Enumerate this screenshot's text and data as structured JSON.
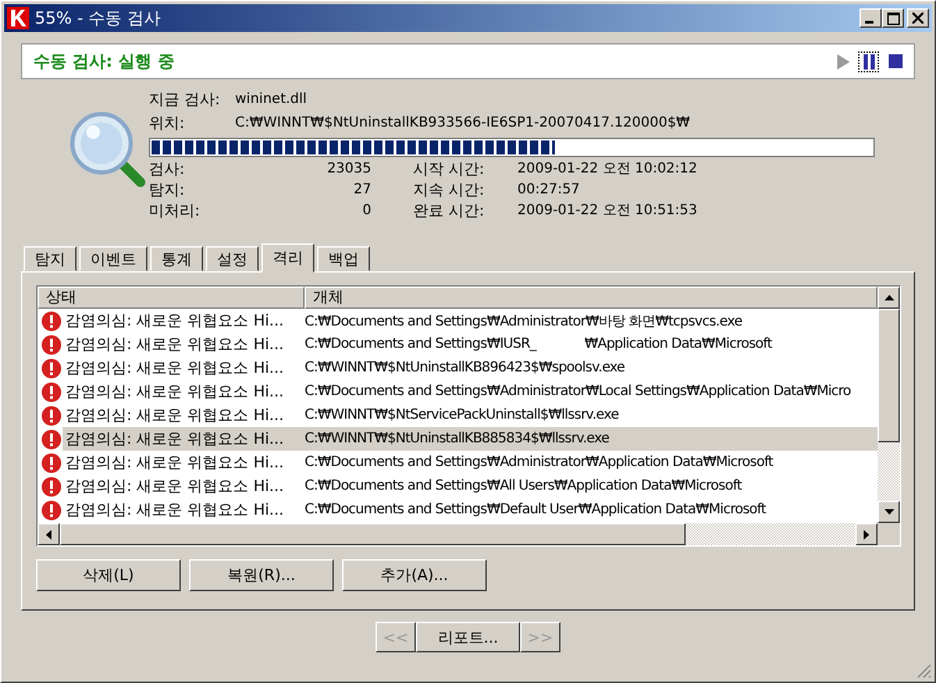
{
  "window": {
    "title": "55% - 수동 검사"
  },
  "header": {
    "title": "수동 검사: 실행 중",
    "controls": [
      {
        "kind": "play",
        "disabled": true,
        "selected": false
      },
      {
        "kind": "pause",
        "disabled": false,
        "selected": true
      },
      {
        "kind": "stop",
        "disabled": false,
        "selected": false
      }
    ]
  },
  "scan": {
    "current_label": "지금 검사:",
    "current_value": "wininet.dll",
    "location_label": "위치:",
    "location_value": "C:₩WINNT₩$NtUninstallKB933566-IE6SP1-20070417.120000$₩",
    "progress": {
      "level": 0.56
    },
    "stats": [
      {
        "label": "검사:",
        "value": "23035",
        "time_label": "시작 시간:",
        "time_value": "2009-01-22 오전 10:02:12"
      },
      {
        "label": "탐지:",
        "value": "27",
        "time_label": "지속 시간:",
        "time_value": "00:27:57"
      },
      {
        "label": "미처리:",
        "value": "0",
        "time_label": "완료 시간:",
        "time_value": "2009-01-22 오전 10:51:53"
      }
    ]
  },
  "tabs": [
    {
      "label": "탐지",
      "selected": false
    },
    {
      "label": "이벤트",
      "selected": false
    },
    {
      "label": "통계",
      "selected": false
    },
    {
      "label": "설정",
      "selected": false
    },
    {
      "label": "격리",
      "selected": true
    },
    {
      "label": "백업",
      "selected": false
    }
  ],
  "table": {
    "columns": [
      "상태",
      "개체"
    ],
    "rows": [
      {
        "status": "감염의심: 새로운 위협요소 Hi...",
        "object": "C:₩Documents and Settings₩Administrator₩바탕 화면₩tcpsvcs.exe",
        "selected": false
      },
      {
        "status": "감염의심: 새로운 위협요소 Hi...",
        "object": "C:₩Documents and Settings₩IUSR_             ₩Application Data₩Microsoft",
        "selected": false
      },
      {
        "status": "감염의심: 새로운 위협요소 Hi...",
        "object": "C:₩WINNT₩$NtUninstallKB896423$₩spoolsv.exe",
        "selected": false
      },
      {
        "status": "감염의심: 새로운 위협요소 Hi...",
        "object": "C:₩Documents and Settings₩Administrator₩Local Settings₩Application Data₩Micro",
        "selected": false
      },
      {
        "status": "감염의심: 새로운 위협요소 Hi...",
        "object": "C:₩WINNT₩$NtServicePackUninstall$₩llssrv.exe",
        "selected": false
      },
      {
        "status": "감염의심: 새로운 위협요소 Hi...",
        "object": "C:₩WINNT₩$NtUninstallKB885834$₩llssrv.exe",
        "selected": true
      },
      {
        "status": "감염의심: 새로운 위협요소 Hi...",
        "object": "C:₩Documents and Settings₩Administrator₩Application Data₩Microsoft",
        "selected": false
      },
      {
        "status": "감염의심: 새로운 위협요소 Hi...",
        "object": "C:₩Documents and Settings₩All Users₩Application Data₩Microsoft",
        "selected": false
      },
      {
        "status": "감염의심: 새로운 위협요소 Hi...",
        "object": "C:₩Documents and Settings₩Default User₩Application Data₩Microsoft",
        "selected": false
      }
    ]
  },
  "buttons": [
    "삭제(L)",
    "복원(R)...",
    "추가(A)..."
  ],
  "nav": [
    {
      "label": "<<",
      "disabled": true
    },
    {
      "label": "리포트...",
      "disabled": false
    },
    {
      "label": ">>",
      "disabled": true
    }
  ]
}
